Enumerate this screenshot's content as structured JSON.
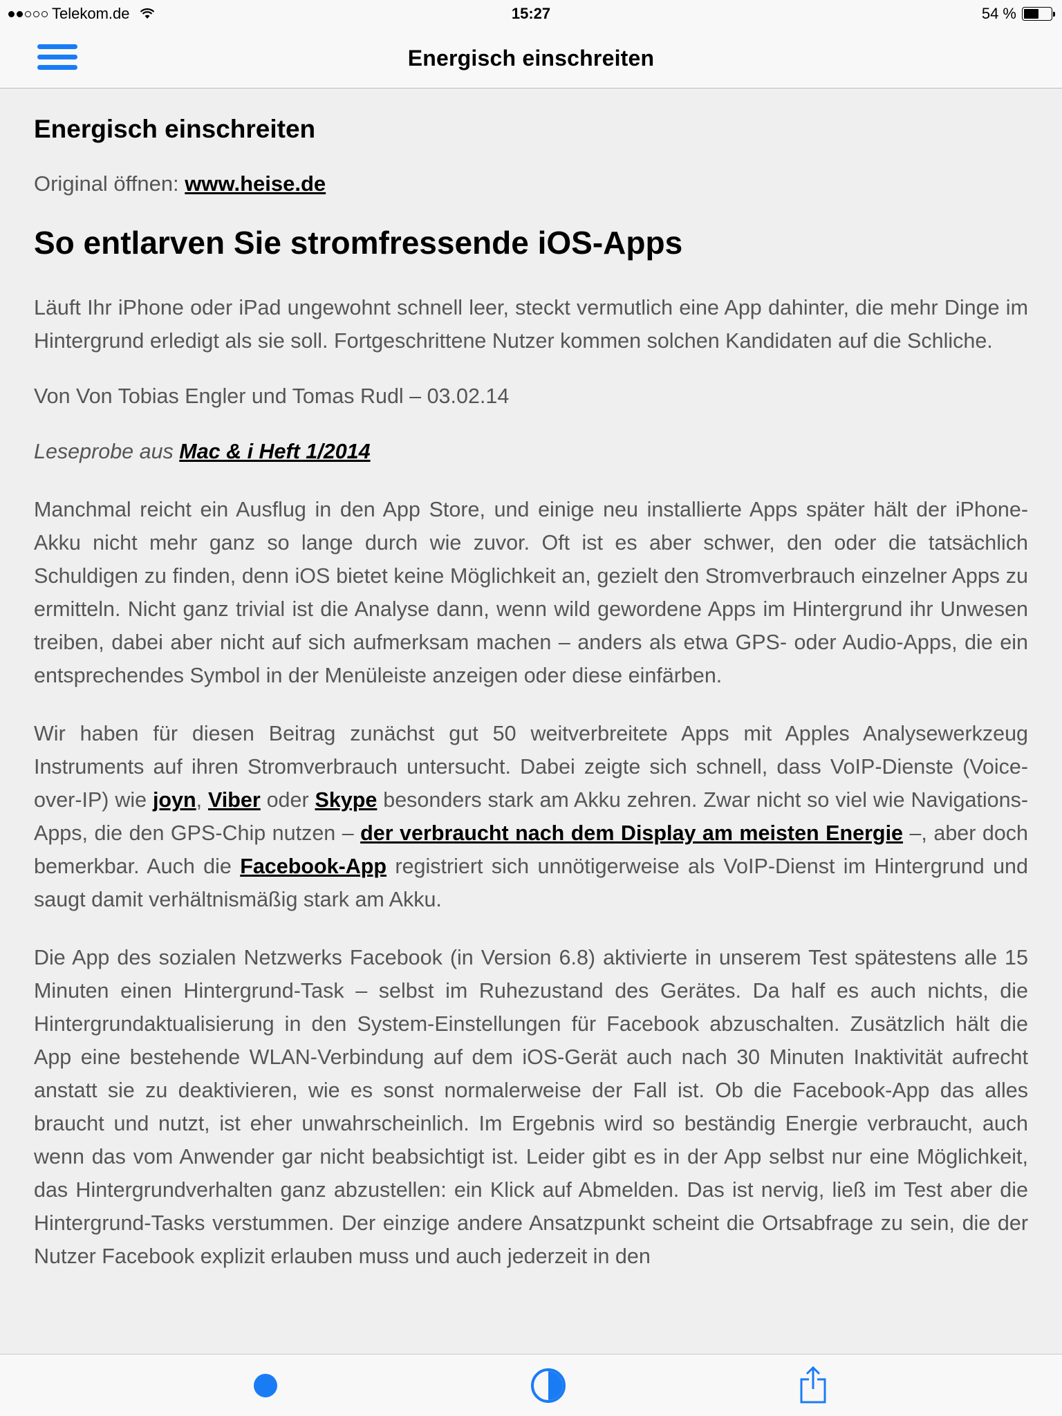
{
  "status_bar": {
    "carrier": "Telekom.de",
    "time": "15:27",
    "battery_text": "54 %",
    "battery_level": 0.54
  },
  "nav": {
    "title": "Energisch einschreiten"
  },
  "article": {
    "heading": "Energisch einschreiten",
    "original_prefix": "Original öffnen: ",
    "original_link": "www.heise.de",
    "title": "So entlarven Sie stromfressende iOS-Apps",
    "intro": "Läuft Ihr iPhone oder iPad ungewohnt schnell leer, steckt vermutlich eine App dahinter, die mehr Dinge im Hintergrund erledigt als sie soll. Fortgeschrittene Nutzer kommen solchen Kandidaten auf die Schliche.",
    "byline": "Von Von Tobias Engler und Tomas Rudl – 03.02.14",
    "source_prefix": "Leseprobe aus ",
    "source_link": "Mac & i Heft 1/2014",
    "p1": "Manchmal reicht ein Ausflug in den App Store, und einige neu installierte Apps später hält der iPhone-Akku nicht mehr ganz so lange durch wie zuvor. Oft ist es aber schwer, den oder die tatsächlich Schuldigen zu finden, denn iOS bietet keine Möglichkeit an, gezielt den Stromverbrauch einzelner Apps zu ermitteln. Nicht ganz trivial ist die Analyse dann, wenn wild gewordene Apps im Hintergrund ihr Unwesen treiben, dabei aber nicht auf sich aufmerksam machen – anders als etwa GPS- oder Audio-Apps, die ein entsprechendes Symbol in der Menüleiste anzeigen oder diese einfärben.",
    "p2": {
      "t1": "Wir haben für diesen Beitrag zunächst gut 50 weitverbreitete Apps mit Apples Analysewerkzeug Instruments auf ihren Stromverbrauch untersucht. Dabei zeigte sich schnell, dass VoIP-Dienste (Voice-over-IP) wie ",
      "l1": "joyn",
      "t2": ", ",
      "l2": "Viber",
      "t3": " oder ",
      "l3": "Skype",
      "t4": " besonders stark am Akku zehren. Zwar nicht so viel wie Navigations-Apps, die den GPS-Chip nutzen – ",
      "l4": "der verbraucht nach dem Display am meisten Energie",
      "t5": " –, aber doch bemerkbar. Auch die ",
      "l5": "Facebook-App",
      "t6": " registriert sich unnötigerweise als VoIP-Dienst im Hintergrund und saugt damit verhältnismäßig stark am Akku."
    },
    "p3": "Die App des sozialen Netzwerks Facebook (in Version 6.8) aktivierte in unserem Test spätestens alle 15 Minuten einen Hintergrund-Task – selbst im Ruhezustand des Gerätes. Da half es auch nichts, die Hintergrundaktualisierung in den System-Einstellungen für Facebook abzuschalten. Zusätzlich hält die App eine bestehende WLAN-Verbindung auf dem iOS-Gerät auch nach 30 Minuten Inaktivität aufrecht anstatt sie zu deaktivieren, wie es sonst normalerweise der Fall ist. Ob die Facebook-App das alles braucht und nutzt, ist eher unwahrscheinlich. Im Ergebnis wird so beständig Energie verbraucht, auch wenn das vom Anwender gar nicht beabsichtigt ist. Leider gibt es in der App selbst nur eine Möglichkeit, das Hintergrundverhalten ganz abzustellen: ein Klick auf Abmelden. Das ist nervig, ließ im Test aber die Hintergrund-Tasks verstummen. Der einzige andere Ansatzpunkt scheint die Ortsabfrage zu sein, die der Nutzer Facebook explizit erlauben muss und auch jederzeit in den"
  },
  "toolbar": {
    "icons": [
      "dot-icon",
      "contrast-icon",
      "share-icon"
    ],
    "accent_color": "#1a7cf5"
  }
}
